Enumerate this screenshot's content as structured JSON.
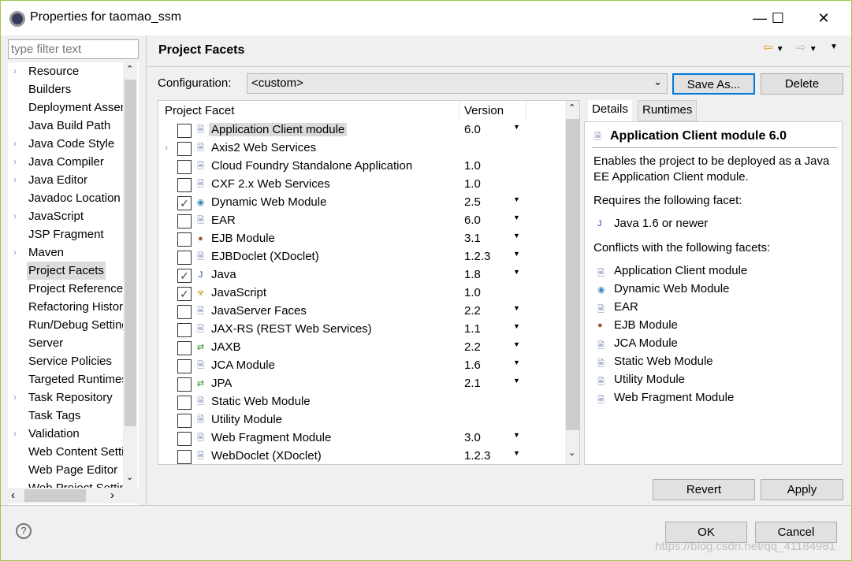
{
  "window": {
    "title": "Properties for taomao_ssm"
  },
  "sidebar": {
    "filter_placeholder": "type filter text",
    "items": [
      {
        "label": "Resource",
        "expandable": true
      },
      {
        "label": "Builders",
        "expandable": false
      },
      {
        "label": "Deployment Assembly",
        "expandable": false
      },
      {
        "label": "Java Build Path",
        "expandable": false
      },
      {
        "label": "Java Code Style",
        "expandable": true
      },
      {
        "label": "Java Compiler",
        "expandable": true
      },
      {
        "label": "Java Editor",
        "expandable": true
      },
      {
        "label": "Javadoc Location",
        "expandable": false
      },
      {
        "label": "JavaScript",
        "expandable": true
      },
      {
        "label": "JSP Fragment",
        "expandable": false
      },
      {
        "label": "Maven",
        "expandable": true
      },
      {
        "label": "Project Facets",
        "expandable": false,
        "selected": true
      },
      {
        "label": "Project References",
        "expandable": false
      },
      {
        "label": "Refactoring History",
        "expandable": false
      },
      {
        "label": "Run/Debug Settings",
        "expandable": false
      },
      {
        "label": "Server",
        "expandable": false
      },
      {
        "label": "Service Policies",
        "expandable": false
      },
      {
        "label": "Targeted Runtimes",
        "expandable": false
      },
      {
        "label": "Task Repository",
        "expandable": true
      },
      {
        "label": "Task Tags",
        "expandable": false
      },
      {
        "label": "Validation",
        "expandable": true
      },
      {
        "label": "Web Content Settings",
        "expandable": false
      },
      {
        "label": "Web Page Editor",
        "expandable": false
      },
      {
        "label": "Web Project Settings",
        "expandable": false
      }
    ]
  },
  "page": {
    "title": "Project Facets",
    "config_label": "Configuration:",
    "config_value": "<custom>",
    "save_as": "Save As...",
    "delete": "Delete"
  },
  "facets": {
    "col_facet": "Project Facet",
    "col_version": "Version",
    "rows": [
      {
        "name": "Application Client module",
        "version": "6.0",
        "dropdown": true,
        "checked": false,
        "icon": "doc",
        "highlight": true
      },
      {
        "name": "Axis2 Web Services",
        "version": "",
        "dropdown": false,
        "checked": false,
        "icon": "doc",
        "expandable": true
      },
      {
        "name": "Cloud Foundry Standalone Application",
        "version": "1.0",
        "dropdown": false,
        "checked": false,
        "icon": "doc"
      },
      {
        "name": "CXF 2.x Web Services",
        "version": "1.0",
        "dropdown": false,
        "checked": false,
        "icon": "doc"
      },
      {
        "name": "Dynamic Web Module",
        "version": "2.5",
        "dropdown": true,
        "checked": true,
        "icon": "globe"
      },
      {
        "name": "EAR",
        "version": "6.0",
        "dropdown": true,
        "checked": false,
        "icon": "doc"
      },
      {
        "name": "EJB Module",
        "version": "3.1",
        "dropdown": true,
        "checked": false,
        "icon": "bean"
      },
      {
        "name": "EJBDoclet (XDoclet)",
        "version": "1.2.3",
        "dropdown": true,
        "checked": false,
        "icon": "doc"
      },
      {
        "name": "Java",
        "version": "1.8",
        "dropdown": true,
        "checked": true,
        "icon": "java"
      },
      {
        "name": "JavaScript",
        "version": "1.0",
        "dropdown": false,
        "checked": true,
        "icon": "js"
      },
      {
        "name": "JavaServer Faces",
        "version": "2.2",
        "dropdown": true,
        "checked": false,
        "icon": "doc"
      },
      {
        "name": "JAX-RS (REST Web Services)",
        "version": "1.1",
        "dropdown": true,
        "checked": false,
        "icon": "doc"
      },
      {
        "name": "JAXB",
        "version": "2.2",
        "dropdown": true,
        "checked": false,
        "icon": "arrows"
      },
      {
        "name": "JCA Module",
        "version": "1.6",
        "dropdown": true,
        "checked": false,
        "icon": "doc"
      },
      {
        "name": "JPA",
        "version": "2.1",
        "dropdown": true,
        "checked": false,
        "icon": "arrows"
      },
      {
        "name": "Static Web Module",
        "version": "",
        "dropdown": false,
        "checked": false,
        "icon": "doc"
      },
      {
        "name": "Utility Module",
        "version": "",
        "dropdown": false,
        "checked": false,
        "icon": "doc"
      },
      {
        "name": "Web Fragment Module",
        "version": "3.0",
        "dropdown": true,
        "checked": false,
        "icon": "doc"
      },
      {
        "name": "WebDoclet (XDoclet)",
        "version": "1.2.3",
        "dropdown": true,
        "checked": false,
        "icon": "doc"
      }
    ]
  },
  "details": {
    "tabs": [
      "Details",
      "Runtimes"
    ],
    "title": "Application Client module 6.0",
    "description": "Enables the project to be deployed as a Java EE Application Client module.",
    "requires_label": "Requires the following facet:",
    "requires": [
      {
        "name": "Java 1.6 or newer",
        "icon": "java"
      }
    ],
    "conflicts_label": "Conflicts with the following facets:",
    "conflicts": [
      {
        "name": "Application Client module",
        "icon": "doc"
      },
      {
        "name": "Dynamic Web Module",
        "icon": "globe"
      },
      {
        "name": "EAR",
        "icon": "doc"
      },
      {
        "name": "EJB Module",
        "icon": "bean"
      },
      {
        "name": "JCA Module",
        "icon": "doc"
      },
      {
        "name": "Static Web Module",
        "icon": "doc"
      },
      {
        "name": "Utility Module",
        "icon": "doc"
      },
      {
        "name": "Web Fragment Module",
        "icon": "doc"
      }
    ]
  },
  "buttons": {
    "revert": "Revert",
    "apply": "Apply",
    "ok": "OK",
    "cancel": "Cancel"
  },
  "watermark": "https://blog.csdn.net/qq_41184981"
}
